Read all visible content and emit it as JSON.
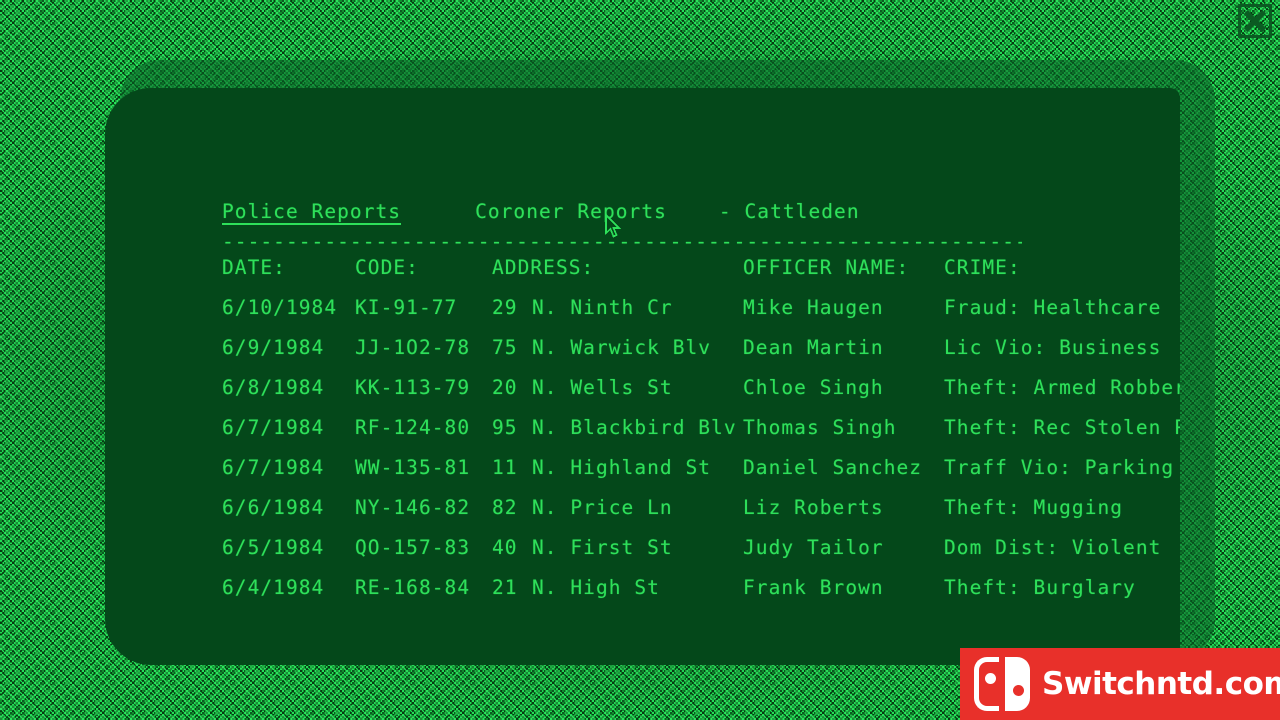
{
  "window": {
    "close_button": "close-icon"
  },
  "header": {
    "tabs": [
      {
        "label": "Police Reports",
        "active": true
      },
      {
        "label": "Coroner Reports",
        "active": false
      }
    ],
    "location": "- Cattleden",
    "divider": "---------------------------------------------------------------------------------"
  },
  "table": {
    "columns": [
      "DATE:",
      "CODE:",
      "ADDRESS:",
      "OFFICER NAME:",
      "CRIME:"
    ],
    "rows": [
      {
        "date": "6/10/1984",
        "code": "KI-91-77",
        "num": "29",
        "street": "N. Ninth Cr",
        "officer": "Mike Haugen",
        "crime": "Fraud: Healthcare"
      },
      {
        "date": "6/9/1984",
        "code": "JJ-1O2-78",
        "num": "75",
        "street": "N. Warwick Blv",
        "officer": "Dean Martin",
        "crime": "Lic Vio: Business"
      },
      {
        "date": "6/8/1984",
        "code": "KK-113-79",
        "num": "20",
        "street": "N. Wells St",
        "officer": "Chloe Singh",
        "crime": "Theft: Armed Robbery"
      },
      {
        "date": "6/7/1984",
        "code": "RF-124-80",
        "num": "95",
        "street": "N. Blackbird Blv",
        "officer": "Thomas Singh",
        "crime": "Theft: Rec Stolen Prop"
      },
      {
        "date": "6/7/1984",
        "code": "WW-135-81",
        "num": "11",
        "street": "N. Highland St",
        "officer": "Daniel Sanchez",
        "crime": "Traff Vio: Parking"
      },
      {
        "date": "6/6/1984",
        "code": "NY-146-82",
        "num": "82",
        "street": "N. Price Ln",
        "officer": "Liz Roberts",
        "crime": "Theft: Mugging"
      },
      {
        "date": "6/5/1984",
        "code": "QO-157-83",
        "num": "40",
        "street": "N. First St",
        "officer": "Judy Tailor",
        "crime": "Dom Dist: Violent"
      },
      {
        "date": "6/4/1984",
        "code": "RE-168-84",
        "num": "21",
        "street": "N. High St",
        "officer": "Frank Brown",
        "crime": "Theft: Burglary"
      }
    ]
  },
  "watermark": {
    "text": "Switchntd.com",
    "brand_color": "#e8302a"
  },
  "colors": {
    "screen_green": "#22dd55",
    "panel_dark": "#04481a",
    "text_green": "#2ee05a"
  }
}
